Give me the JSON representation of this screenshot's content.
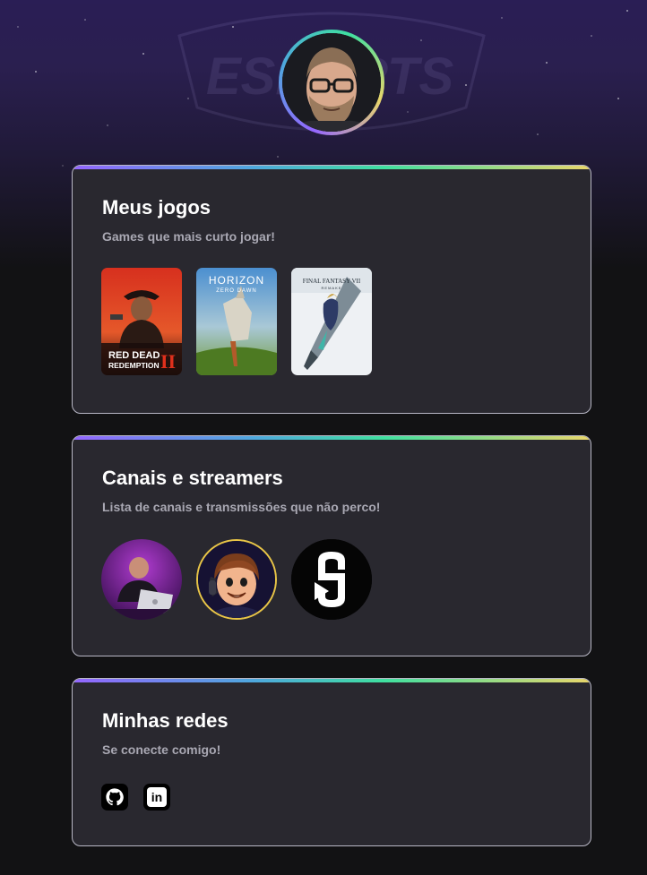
{
  "profile": {
    "avatar_alt": "Foto de perfil"
  },
  "games_card": {
    "title": "Meus jogos",
    "subtitle": "Games que mais curto jogar!",
    "games": [
      {
        "name": "Red Dead Redemption II",
        "cover_line1": "RED DEAD",
        "cover_line2": "REDEMPTION",
        "cover_number": "II"
      },
      {
        "name": "Horizon Zero Dawn",
        "cover_line1": "HORIZON",
        "cover_line2": "ZERO DAWN"
      },
      {
        "name": "Final Fantasy VII Remake",
        "cover_line1": "FINAL FANTASY VII",
        "cover_line2": "REMAKE"
      }
    ]
  },
  "channels_card": {
    "title": "Canais e streamers",
    "subtitle": "Lista de canais e transmissões que não perco!",
    "channels": [
      {
        "kind": "streamer-avatar"
      },
      {
        "kind": "cartoon-avatar"
      },
      {
        "kind": "logo-avatar"
      }
    ]
  },
  "socials_card": {
    "title": "Minhas redes",
    "subtitle": "Se conecte comigo!",
    "links": [
      {
        "icon": "github-icon"
      },
      {
        "icon": "linkedin-icon",
        "glyph": "in"
      }
    ]
  },
  "colors": {
    "background": "#121214",
    "card": "#29282f",
    "card_border": "#b9b8c6",
    "gradient": [
      "#9466ff",
      "#4ea8de",
      "#3fe0a0",
      "#e8d66b"
    ],
    "title": "#ffffff",
    "subtitle": "#a9a8b3"
  }
}
